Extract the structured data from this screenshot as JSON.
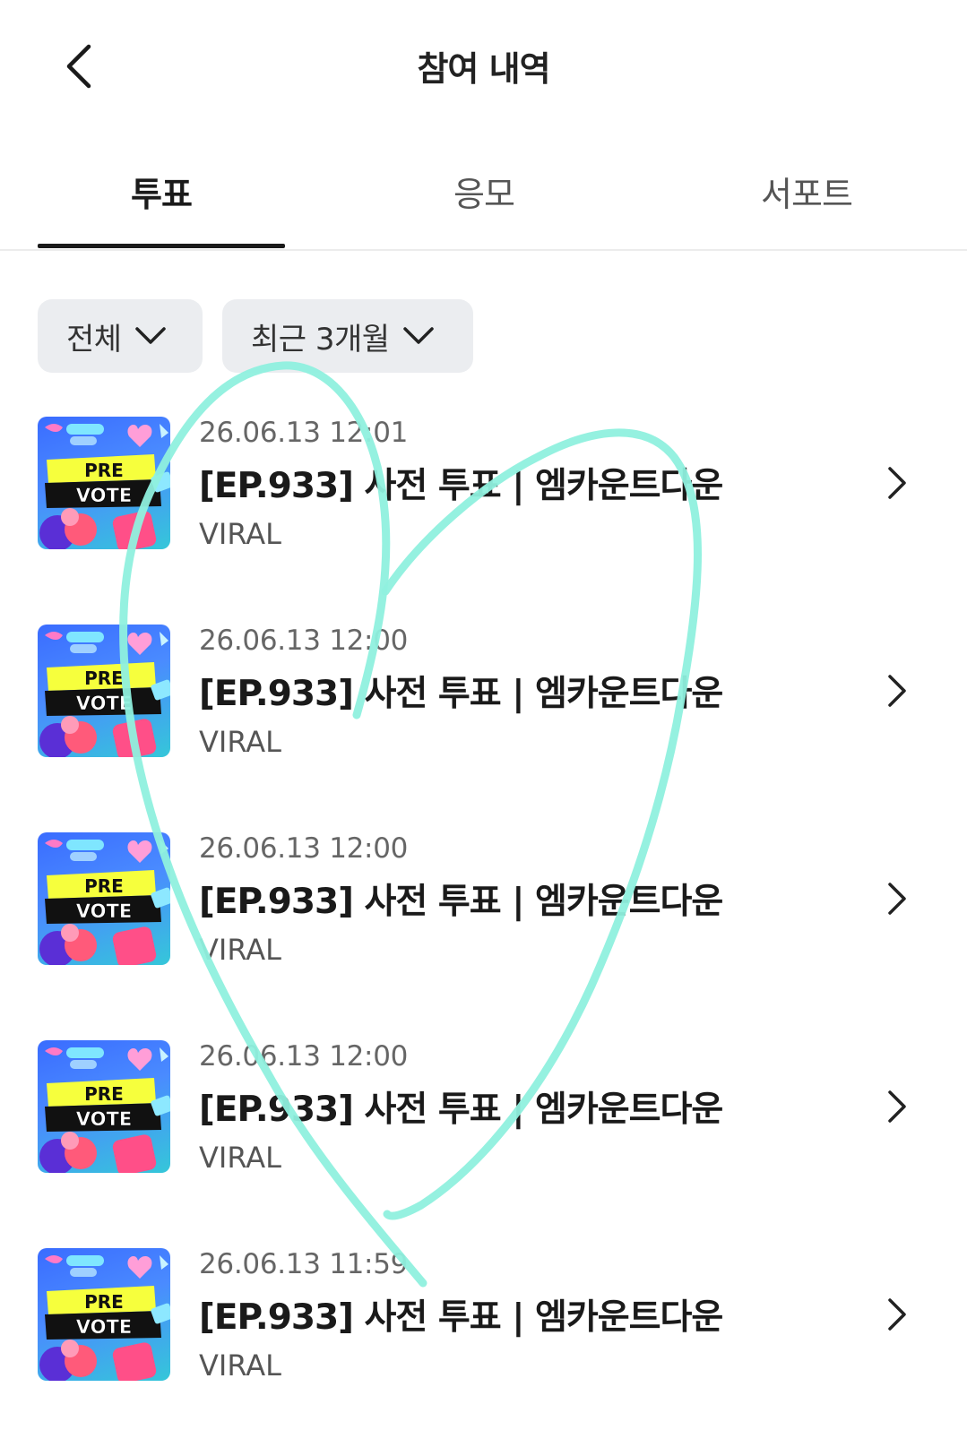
{
  "header": {
    "title": "참여 내역"
  },
  "tabs": [
    {
      "label": "투표",
      "active": true
    },
    {
      "label": "응모",
      "active": false
    },
    {
      "label": "서포트",
      "active": false
    }
  ],
  "filters": {
    "category": "전체",
    "period": "최근 3개월"
  },
  "items": [
    {
      "date": "26.06.13 12:01",
      "title": "[EP.933] 사전 투표 | 엠카운트다운",
      "subtitle": "VIRAL",
      "thumb_top": "PRE",
      "thumb_bottom": "VOTE"
    },
    {
      "date": "26.06.13 12:00",
      "title": "[EP.933] 사전 투표 | 엠카운트다운",
      "subtitle": "VIRAL",
      "thumb_top": "PRE",
      "thumb_bottom": "VOTE"
    },
    {
      "date": "26.06.13 12:00",
      "title": "[EP.933] 사전 투표 | 엠카운트다운",
      "subtitle": "VIRAL",
      "thumb_top": "PRE",
      "thumb_bottom": "VOTE"
    },
    {
      "date": "26.06.13 12:00",
      "title": "[EP.933] 사전 투표 | 엠카운트다운",
      "subtitle": "VIRAL",
      "thumb_top": "PRE",
      "thumb_bottom": "VOTE"
    },
    {
      "date": "26.06.13 11:59",
      "title": "[EP.933] 사전 투표 | 엠카운트다운",
      "subtitle": "VIRAL",
      "thumb_top": "PRE",
      "thumb_bottom": "VOTE"
    }
  ],
  "icons": {
    "back": "chevron-left-icon",
    "dropdown": "chevron-down-icon",
    "row_arrow": "chevron-right-icon"
  },
  "colors": {
    "active_tab_underline": "#1a1a1a",
    "filter_bg": "#ebedf0",
    "heart_drawing": "#8ff0de"
  }
}
